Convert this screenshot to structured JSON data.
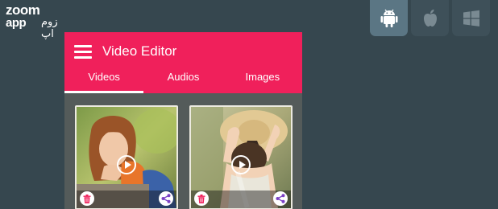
{
  "logo": {
    "line1": "zoom",
    "line2": "app",
    "line3": "زوم اپ"
  },
  "platforms": [
    {
      "name": "android",
      "icon": "android-icon",
      "active": true
    },
    {
      "name": "apple",
      "icon": "apple-icon",
      "active": false
    },
    {
      "name": "windows",
      "icon": "windows-icon",
      "active": false
    }
  ],
  "app": {
    "title": "Video Editor",
    "accent_color": "#f0205b",
    "tabs": [
      {
        "label": "Videos",
        "active": true
      },
      {
        "label": "Audios",
        "active": false
      },
      {
        "label": "Images",
        "active": false
      }
    ]
  },
  "videos": [
    {
      "thumbnail": "girl-portrait",
      "play_icon": "play-icon",
      "delete_icon": "trash-icon",
      "share_icon": "share-icon"
    },
    {
      "thumbnail": "girl-straw-hat",
      "play_icon": "play-icon",
      "delete_icon": "trash-icon",
      "share_icon": "share-icon"
    }
  ]
}
